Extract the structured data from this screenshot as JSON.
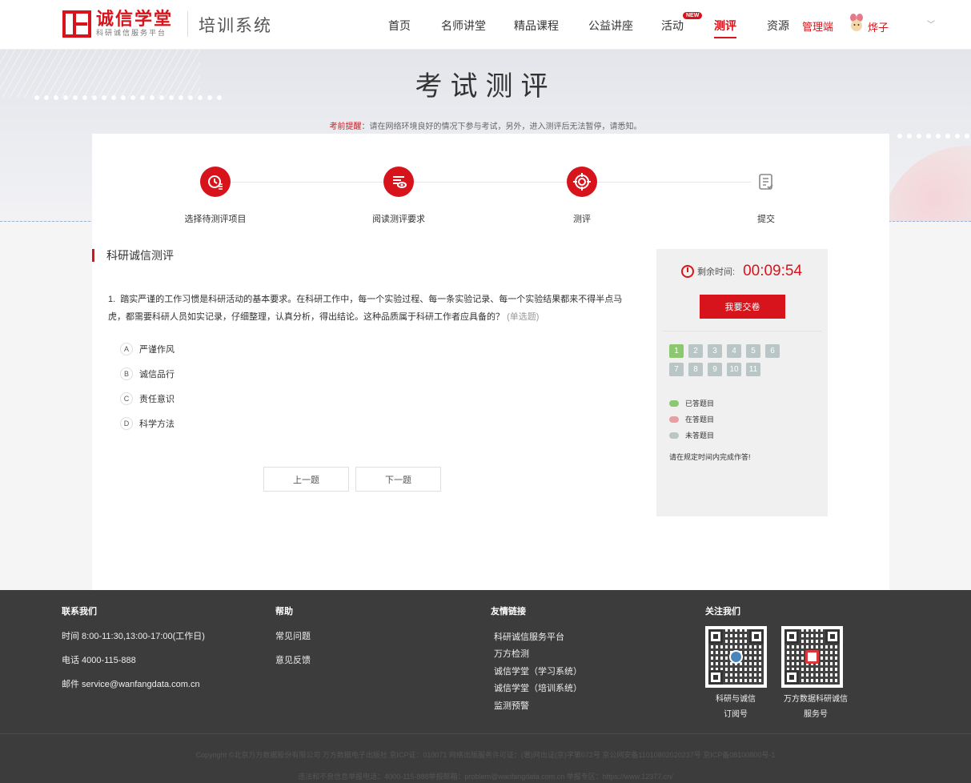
{
  "header": {
    "logo_title": "诚信学堂",
    "logo_subtitle": "科研诚信服务平台",
    "system_name": "培训系统",
    "nav": [
      "首页",
      "名师讲堂",
      "精品课程",
      "公益讲座",
      "活动",
      "测评",
      "资源"
    ],
    "active_nav": "测评",
    "new_badge": "NEW",
    "admin_link": "管理端",
    "username": "烨子"
  },
  "banner": {
    "title": "考试测评",
    "notice_label": "考前提醒",
    "notice_text": "：请在网络环境良好的情况下参与考试，另外，进入测评后无法暂停，请悉知。"
  },
  "steps": [
    {
      "label": "选择待测评项目",
      "state": "done",
      "icon": "clock-list-icon"
    },
    {
      "label": "阅读测评要求",
      "state": "done",
      "icon": "read-eye-icon"
    },
    {
      "label": "测评",
      "state": "current",
      "icon": "target-icon"
    },
    {
      "label": "提交",
      "state": "pending",
      "icon": "document-check-icon"
    }
  ],
  "section_title": "科研诚信测评",
  "question": {
    "number": "1.",
    "text": "踏实严谨的工作习惯是科研活动的基本要求。在科研工作中，每一个实验过程、每一条实验记录、每一个实验结果都来不得半点马虎，都需要科研人员如实记录，仔细整理，认真分析，得出结论。这种品质属于科研工作者应具备的？",
    "type": "(单选题)",
    "options": [
      {
        "letter": "A",
        "text": "严谨作风"
      },
      {
        "letter": "B",
        "text": "诚信品行"
      },
      {
        "letter": "C",
        "text": "责任意识"
      },
      {
        "letter": "D",
        "text": "科学方法"
      }
    ]
  },
  "buttons": {
    "prev": "上一题",
    "next": "下一题",
    "submit": "我要交卷"
  },
  "sidebar": {
    "timer_label": "剩余时间:",
    "timer_value": "00:09:54",
    "question_numbers": [
      "1",
      "2",
      "3",
      "4",
      "5",
      "6",
      "7",
      "8",
      "9",
      "10",
      "11"
    ],
    "answered_count": 1,
    "legend": [
      {
        "label": "已答题目",
        "color": "#8cc86f"
      },
      {
        "label": "在答题目",
        "color": "#e6a0a4"
      },
      {
        "label": "未答题目",
        "color": "#b9c6c5"
      }
    ],
    "note": "请在规定时间内完成作答!"
  },
  "footer": {
    "contact": {
      "title": "联系我们",
      "hours": "时间 8:00-11:30,13:00-17:00(工作日)",
      "phone": "电话 4000-115-888",
      "email": "邮件 service@wanfangdata.com.cn"
    },
    "help": {
      "title": "帮助",
      "items": [
        "常见问题",
        "意见反馈"
      ]
    },
    "links": {
      "title": "友情链接",
      "items": [
        "科研诚信服务平台",
        "万方检测",
        "诚信学堂（学习系统）",
        "诚信学堂（培训系统）",
        "监测预警"
      ]
    },
    "follow": {
      "title": "关注我们",
      "qr1_caption_1": "科研与诚信",
      "qr1_caption_2": "订阅号",
      "qr2_caption_1": "万方数据科研诚信",
      "qr2_caption_2": "服务号"
    },
    "copyright_1": "Copyright ©北京万方数据股份有限公司  万方数据电子出版社  京ICP证：010071  网络出版服务许可证：(署)网出证(京)字第072号  京公网安备11010802020237号  京ICP备08100800号-1",
    "copyright_2": "违法和不良信息举报电话：4000-115-888举报邮箱：problem@wanfangdata.com.cn 举报专区：https://www.12377.cn/"
  },
  "colors": {
    "accent": "#d7141b",
    "footer_bg": "#3c3c3c",
    "answered": "#8cc86f",
    "unanswered": "#b9c6c5"
  }
}
